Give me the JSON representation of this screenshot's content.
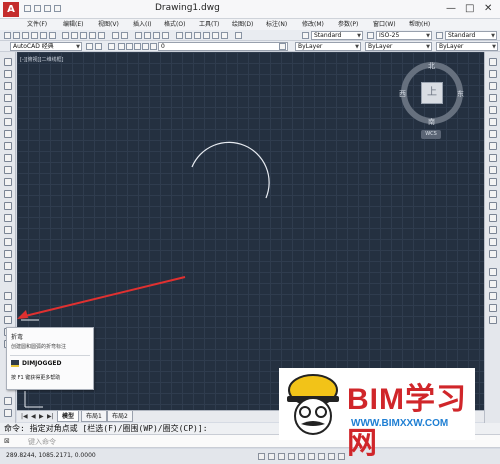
{
  "window": {
    "title": "Drawing1.dwg",
    "logo": "A",
    "controls": {
      "minimize": "—",
      "maximize": "□",
      "close": "✕"
    }
  },
  "menu": {
    "items": [
      "文件(F)",
      "编辑(E)",
      "视图(V)",
      "插入(I)",
      "格式(O)",
      "工具(T)",
      "绘图(D)",
      "标注(N)",
      "修改(M)",
      "参数(P)",
      "窗口(W)",
      "帮助(H)"
    ]
  },
  "toolbar1": {
    "text_style": "Standard",
    "dim_style": "ISO-25",
    "table_style": "Standard"
  },
  "toolbar2": {
    "workspace": "AutoCAD 经典",
    "layer": "0",
    "color": "ByLayer",
    "linetype": "ByLayer",
    "lineweight": "ByLayer"
  },
  "canvas": {
    "viewport_label": "[-][俯视][二维线框]",
    "background_color": "#243040",
    "arc_color": "#e8ecf2",
    "arrow_color": "#e03030"
  },
  "viewcube": {
    "north": "北",
    "south": "南",
    "west": "西",
    "east": "东",
    "top_face": "上",
    "wcs": "WCS"
  },
  "layout_tabs": {
    "nav": [
      "|◀",
      "◀",
      "▶",
      "▶|"
    ],
    "tabs": [
      "模型",
      "布局1",
      "布局2"
    ],
    "active": "模型"
  },
  "command_line": {
    "history": "命令: 指定对角点或 [栏选(F)/圈围(WP)/圈交(CP)]:",
    "placeholder": "键入命令",
    "prompt_glyph": "⊠"
  },
  "status": {
    "coords": "289.8244, 1085.2171, 0.0000"
  },
  "tooltip": {
    "title": "折弯",
    "description": "创建圆和圆弧的折弯标注",
    "command": "DIMJOGGED",
    "help": "按 F1 键获得更多帮助"
  },
  "watermark": {
    "brand": "BIM学习网",
    "url": "WWW.BIMXXW.COM",
    "brand_color": "#d0262a",
    "url_color": "#1f7fd3"
  }
}
